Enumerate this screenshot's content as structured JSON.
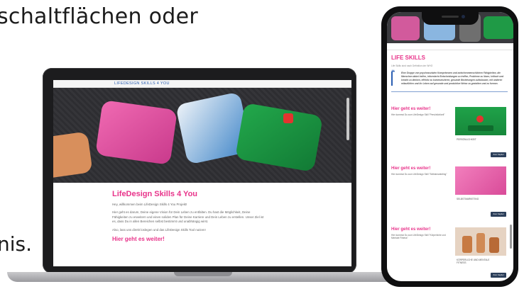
{
  "background_text": {
    "line1": "schaltflächen oder",
    "line2": "nis."
  },
  "laptop_site": {
    "nav_label": "LIFEDESIGN SKILLS 4 YOU",
    "title": "LifeDesign Skills 4 You",
    "greeting": "Hey, willkommen beim LifeDesign Skills 4 You Projekt!",
    "paragraph": "Hier geht es darum, Deine eigene Vision für Dein Leben zu entfalten. Du hast die Möglichkeit, Deine Fähigkeiten zu erweitern und einen soliden Plan für Deine Karriere und Dein Leben zu erstellen. Unser Ziel ist es, dass Du in allen Bereichen selbst bestimmt und unabhängig wirst.",
    "cta_text": "Also, lass uns direkt loslegen und das LifeDesign Skills Tool nutzen!",
    "subheading": "Hier geht es weiter!"
  },
  "phone_site": {
    "title": "LIFE SKILLS",
    "subtitle": "Life Skills sind nach Definition der WHO",
    "quote": "Eine Gruppe von psychosozialen Kompetenzen und zwischenmenschlichen Fähigkeiten, die Menschen dabei helfen, informierte Entscheidungen zu treffen, Probleme zu lösen, kritisch und kreativ zu denken, effektiv zu kommunizieren, gesunde Beziehungen aufzubauen, mit anderen mitzufühlen und ihr Leben auf gesunde und produktive Weise zu gestalten und zu formen.",
    "cards": [
      {
        "heading": "Hier geht es weiter!",
        "text": "Hier kommst Du zum LifeDesign Skill \"Persönlichkeit\"",
        "label": "PERSÖNLICHKEIT",
        "button": "Zum Kapitel"
      },
      {
        "heading": "Hier geht es weiter!",
        "text": "Hier kommst Du zum LifeDesign Skill \"Selbstmarketing\"",
        "label": "SELBSTMARKETING",
        "button": "Zum Kapitel"
      },
      {
        "heading": "Hier geht es weiter!",
        "text": "Hier kommst Du zum LifeDesign Skill \"Körperliche und Mentale Fitness\"",
        "label": "KÖRPERLICHE UND MENTALE FITNESS",
        "button": "Zum Kapitel"
      }
    ]
  },
  "colors": {
    "accent": "#e8338a",
    "link": "#2b5fb3",
    "button": "#2c3f5a"
  }
}
